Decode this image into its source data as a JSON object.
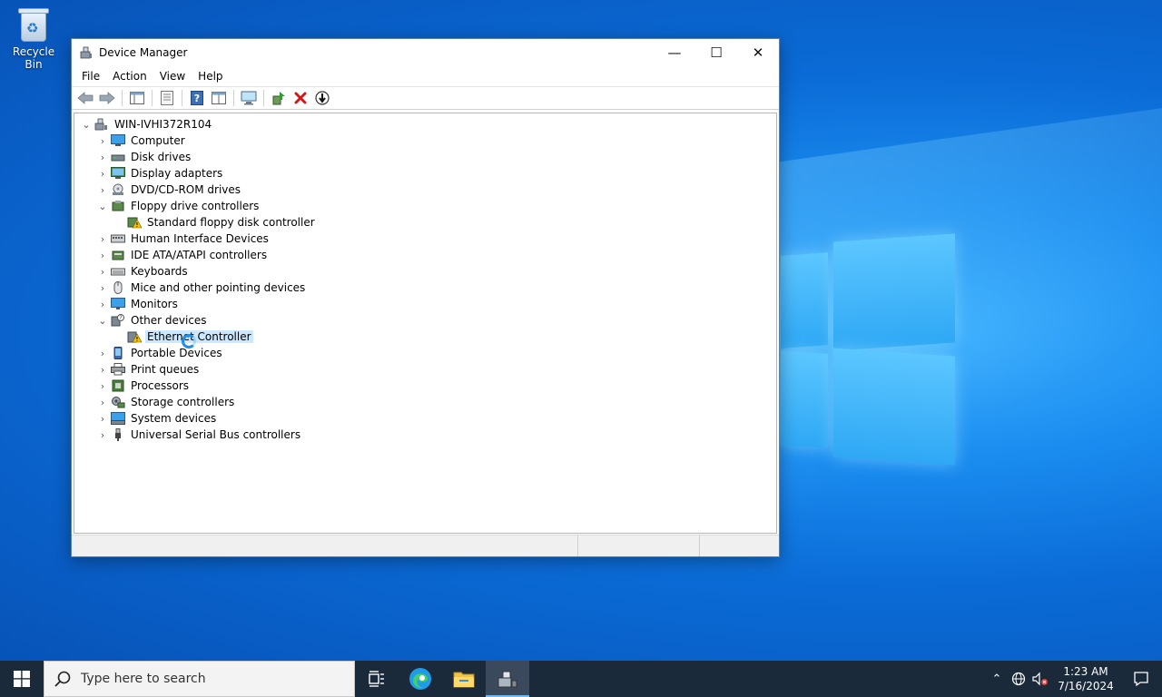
{
  "desktop": {
    "recycle_bin_label": "Recycle Bin"
  },
  "window": {
    "title": "Device Manager",
    "controls": {
      "minimize": "—",
      "maximize": "☐",
      "close": "✕"
    }
  },
  "menu": {
    "items": [
      "File",
      "Action",
      "View",
      "Help"
    ]
  },
  "toolbar": {
    "buttons": [
      "back-icon",
      "forward-icon",
      "show-hide-console-tree-icon",
      "properties-icon",
      "help-icon",
      "view-icon",
      "scan-hardware-icon",
      "update-driver-icon",
      "uninstall-device-icon",
      "disable-device-icon"
    ]
  },
  "tree": {
    "root": "WIN-IVHI372R104",
    "categories": [
      {
        "label": "Computer",
        "expanded": false
      },
      {
        "label": "Disk drives",
        "expanded": false
      },
      {
        "label": "Display adapters",
        "expanded": false
      },
      {
        "label": "DVD/CD-ROM drives",
        "expanded": false
      },
      {
        "label": "Floppy drive controllers",
        "expanded": true
      },
      {
        "label": "Standard floppy disk controller",
        "child": true,
        "warning": true
      },
      {
        "label": "Human Interface Devices",
        "expanded": false
      },
      {
        "label": "IDE ATA/ATAPI controllers",
        "expanded": false
      },
      {
        "label": "Keyboards",
        "expanded": false
      },
      {
        "label": "Mice and other pointing devices",
        "expanded": false
      },
      {
        "label": "Monitors",
        "expanded": false
      },
      {
        "label": "Other devices",
        "expanded": true
      },
      {
        "label": "Ethernet Controller",
        "child": true,
        "warning": true,
        "selected": true
      },
      {
        "label": "Portable Devices",
        "expanded": false
      },
      {
        "label": "Print queues",
        "expanded": false
      },
      {
        "label": "Processors",
        "expanded": false
      },
      {
        "label": "Storage controllers",
        "expanded": false
      },
      {
        "label": "System devices",
        "expanded": false
      },
      {
        "label": "Universal Serial Bus controllers",
        "expanded": false
      }
    ]
  },
  "taskbar": {
    "search_placeholder": "Type here to search",
    "apps": [
      "task-view-icon",
      "edge-icon",
      "file-explorer-icon",
      "device-manager-icon"
    ],
    "clock_time": "1:23 AM",
    "clock_date": "7/16/2024"
  },
  "colors": {
    "selection": "#cce8ff",
    "taskbar": "#1b2a3a",
    "accent": "#76b9ed"
  }
}
